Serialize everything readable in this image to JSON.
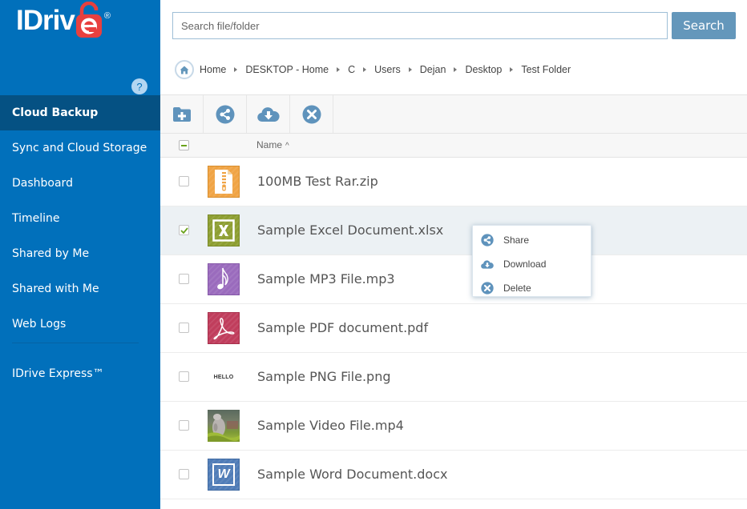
{
  "app": {
    "logo_text": "IDriv",
    "logo_reg": "®"
  },
  "sidebar": {
    "items": [
      {
        "label": "Cloud Backup",
        "active": true
      },
      {
        "label": "Sync and Cloud Storage"
      },
      {
        "label": "Dashboard",
        "badge": "?"
      },
      {
        "label": "Timeline"
      },
      {
        "label": "Shared by Me"
      },
      {
        "label": "Shared with Me"
      },
      {
        "label": "Web Logs"
      }
    ],
    "express": {
      "label": "IDrive Express™"
    }
  },
  "search": {
    "placeholder": "Search file/folder",
    "value": "",
    "button_label": "Search"
  },
  "breadcrumb": {
    "icon": "home-icon",
    "items": [
      "Home",
      "DESKTOP - Home",
      "C",
      "Users",
      "Dejan",
      "Desktop",
      "Test Folder"
    ]
  },
  "toolbar": {
    "buttons": [
      {
        "icon": "new-folder-icon",
        "label": "New Folder"
      },
      {
        "icon": "share-icon",
        "label": "Share"
      },
      {
        "icon": "download-icon",
        "label": "Download"
      },
      {
        "icon": "delete-icon",
        "label": "Delete"
      }
    ]
  },
  "list": {
    "header": {
      "name_label": "Name",
      "sort": "ascending",
      "sort_icon": "^",
      "select_all_state": "partial"
    },
    "files": [
      {
        "name": "100MB Test Rar.zip",
        "type": "zip",
        "checked": false,
        "thumb_color": "#f0a445"
      },
      {
        "name": "Sample Excel Document.xlsx",
        "type": "excel",
        "checked": true,
        "thumb_color": "#8d9e31"
      },
      {
        "name": "Sample MP3 File.mp3",
        "type": "audio",
        "checked": false,
        "thumb_color": "#9a6bbd"
      },
      {
        "name": "Sample PDF document.pdf",
        "type": "pdf",
        "checked": false,
        "thumb_color": "#c03d5c"
      },
      {
        "name": "Sample PNG File.png",
        "type": "image",
        "checked": false,
        "thumb_text": "HELLO"
      },
      {
        "name": "Sample Video File.mp4",
        "type": "video",
        "checked": false
      },
      {
        "name": "Sample Word Document.docx",
        "type": "word",
        "checked": false,
        "thumb_color": "#4f7cb7",
        "thumb_text": "W"
      }
    ]
  },
  "context_menu": {
    "items": [
      {
        "icon": "share-icon",
        "label": "Share"
      },
      {
        "icon": "download-icon",
        "label": "Download"
      },
      {
        "icon": "delete-icon",
        "label": "Delete"
      }
    ]
  },
  "colors": {
    "sidebar_bg": "#0170bb",
    "sidebar_active": "#055183",
    "accent_button": "#6497bb",
    "icon_blue": "#5f93bc",
    "check_green": "#6aa31c",
    "logo_red": "#e8403f"
  }
}
